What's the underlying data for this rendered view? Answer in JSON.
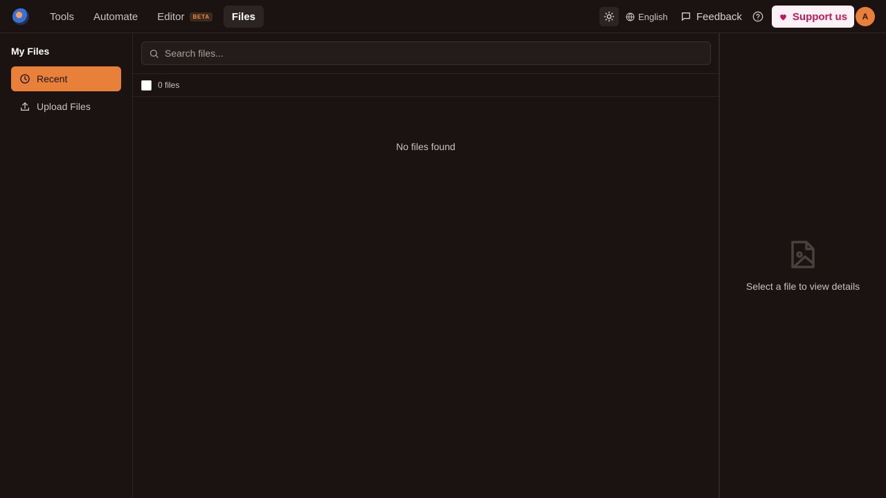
{
  "nav": {
    "items": [
      {
        "label": "Tools"
      },
      {
        "label": "Automate"
      },
      {
        "label": "Editor",
        "badge": "BETA"
      },
      {
        "label": "Files",
        "active": true
      }
    ]
  },
  "header": {
    "language": "English",
    "feedback": "Feedback",
    "support": "Support us",
    "avatar_initial": "A"
  },
  "sidebar": {
    "title": "My Files",
    "items": [
      {
        "label": "Recent",
        "icon": "clock-icon",
        "active": true
      },
      {
        "label": "Upload Files",
        "icon": "upload-icon"
      }
    ]
  },
  "main": {
    "search_placeholder": "Search files...",
    "file_count": "0 files",
    "empty_message": "No files found"
  },
  "details": {
    "empty_message": "Select a file to view details"
  },
  "colors": {
    "background": "#1b1212",
    "accent": "#e8803a",
    "support_text": "#c2185b"
  }
}
